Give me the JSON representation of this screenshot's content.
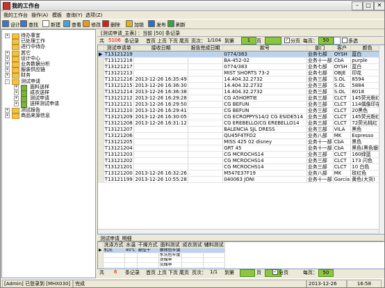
{
  "window": {
    "title": "我的工作台"
  },
  "menu": [
    "我的工作台",
    "操作(A)",
    "模板",
    "查询(Y)",
    "选项(Z)"
  ],
  "toolbar": [
    {
      "label": "设计",
      "color": "#3b78c8"
    },
    {
      "label": "查找",
      "color": "#3b78c8"
    },
    {
      "label": "新建",
      "color": "#ffffff"
    },
    {
      "label": "查看",
      "color": "#4aa0d8"
    },
    {
      "label": "修改",
      "color": "#e09a2a"
    },
    {
      "label": "删除",
      "color": "#d02020"
    },
    {
      "label": "加锁",
      "color": "#e0b020"
    },
    {
      "label": "发布",
      "color": "#3070c0"
    },
    {
      "label": "刷新",
      "color": "#40a040"
    }
  ],
  "tree": [
    {
      "label": "待办事宜",
      "indent": 0,
      "exp": "+"
    },
    {
      "label": "已处理工作",
      "indent": 0,
      "exp": ""
    },
    {
      "label": "进行中待办",
      "indent": 0,
      "exp": ""
    },
    {
      "label": "其它",
      "indent": 0,
      "exp": "+"
    },
    {
      "label": "设计中心",
      "indent": 0,
      "exp": "+"
    },
    {
      "label": "业务数据分析",
      "indent": 0,
      "exp": "+"
    },
    {
      "label": "服装供应链",
      "indent": 0,
      "exp": "+"
    },
    {
      "label": "财务",
      "indent": 0,
      "exp": "+"
    },
    {
      "label": "测试申请",
      "indent": 0,
      "exp": "-"
    },
    {
      "label": "面料送样",
      "indent": 1,
      "exp": "+"
    },
    {
      "label": "成衣送样",
      "indent": 1,
      "exp": "+"
    },
    {
      "label": "测试申请",
      "indent": 1,
      "exp": "+"
    },
    {
      "label": "送样测试申请",
      "indent": 1,
      "exp": "+"
    },
    {
      "label": "测试报告",
      "indent": 0,
      "exp": "+"
    },
    {
      "label": "商品来源信息",
      "indent": 0,
      "exp": "+"
    }
  ],
  "main": {
    "tab_title": "[测试申请_主表] ：当前 [50] 条记录",
    "pager": {
      "total_label": "共",
      "total": "5106",
      "records_label": "条记录",
      "first": "首页",
      "prev": "上页",
      "next": "下页",
      "last": "尾页",
      "page_label": "页次：",
      "page": "1/104",
      "goto_label": "到第",
      "goto_value": "1",
      "page_unit": "页",
      "split_label": "分页",
      "per_page_label": "每页：",
      "per_page": "50",
      "multi_label": "多选"
    },
    "columns": [
      "测试申请单",
      "接收日期",
      "报告完成日期",
      "款号",
      "部门",
      "客户",
      "颜色"
    ],
    "rows": [
      [
        "T13121219",
        "",
        "",
        "0774/383",
        "业务七部",
        "OYSH",
        "蓝白"
      ],
      [
        "T13121218",
        "",
        "",
        "BA-452-02",
        "业务十一部",
        "CbA",
        "purple"
      ],
      [
        "T13121217",
        "",
        "",
        "0774/383",
        "业务七部",
        "OYSH",
        "蓝白"
      ],
      [
        "T13121213",
        "",
        "",
        "MIST SHORTS 73-2",
        "业务七部",
        "OBJE",
        "印花"
      ],
      [
        "T13121216",
        "2013-12-26 16:35:49",
        "",
        "14.404.32.2732",
        "业务三部",
        "S.OL",
        "8594"
      ],
      [
        "T13121215",
        "2013-12-26 16:36:30",
        "",
        "14.404.32.2732",
        "业务三部",
        "S.OL",
        "5884"
      ],
      [
        "T13121214",
        "2013-12-26 16:36:38",
        "",
        "14.404.32.2732",
        "业务三部",
        "S.OL",
        "8018"
      ],
      [
        "T13121212",
        "2013-12-26 16:29:28",
        "",
        "CG A5HORTIE",
        "业务三部",
        "CLCT",
        "145荧光粉红"
      ],
      [
        "T13121211",
        "2013-12-26 16:29:50",
        "",
        "CG BEFUN",
        "业务三部",
        "CLCT",
        "114偶像印花"
      ],
      [
        "T13121210",
        "2013-12-26 16:29:41",
        "",
        "CG BEFUN",
        "业务三部",
        "CLCT",
        "20黑色"
      ],
      [
        "T13121209",
        "2013-12-26 16:30:05",
        "",
        "CG ECROPPYS14/2 CG ESIDE514",
        "业务三部",
        "CLCT",
        "145荧光粉红"
      ],
      [
        "T13121208",
        "2013-12-26 16:31:12",
        "",
        "CG EREBELLO/CG EREBELLO14",
        "业务三部",
        "CLCT",
        "72荧光桃红"
      ],
      [
        "T13121207",
        "",
        "",
        "BALENCIA SJL DRESS",
        "业务三部",
        "VILA",
        "黑色"
      ],
      [
        "T13121206",
        "",
        "",
        "QU45F4TFD2",
        "业务八部",
        "MK",
        "Espresso"
      ],
      [
        "T13121205",
        "",
        "",
        "MISS 425 02 disney",
        "业务十一部",
        "CbA",
        "黑色"
      ],
      [
        "T13121204",
        "",
        "",
        "GRT 45",
        "业务十一部",
        "CbA",
        "黑色(黑色银箔"
      ],
      [
        "T13121203",
        "",
        "",
        "CG MCROCHS14",
        "业务三部",
        "CLCT",
        "160绿蓝"
      ],
      [
        "T13121202",
        "",
        "",
        "CG MCROCHS14",
        "业务三部",
        "CLCT",
        "173 闪色"
      ],
      [
        "T13121201",
        "",
        "",
        "CG MCROCHS14",
        "业务三部",
        "CLCT",
        "10 白色"
      ],
      [
        "T13121200",
        "2013-12-26 16:32:26",
        "",
        "M547E37F19",
        "业务八部",
        "MK",
        "玫红色"
      ],
      [
        "T13121199",
        "2013-12-26 10:55:28",
        "",
        "040063 JONI",
        "业务十一部",
        "Garcia",
        "黄色(大货)"
      ]
    ]
  },
  "detail": {
    "tab_title": "测试申请_明细",
    "columns": [
      "洗涤方式",
      "水温",
      "干燥方式",
      "面料测试",
      "成衣测试",
      "辅料测试"
    ],
    "rows": [
      [
        "机洗",
        "40℃",
        "悬挂干",
        "摩擦色牢度",
        "",
        ""
      ],
      [
        "",
        "",
        "",
        "水洗色牢度",
        "",
        ""
      ],
      [
        "",
        "",
        "",
        "烫缩率",
        "",
        ""
      ],
      [
        "",
        "",
        "",
        "洗缩率",
        "",
        ""
      ],
      [
        "",
        "",
        "",
        "",
        "",
        " "
      ]
    ],
    "pager": {
      "total_label": "共",
      "total": "6",
      "records_label": "条记录",
      "first": "首页",
      "prev": "上页",
      "next": "下页",
      "last": "尾页",
      "page_label": "页次：",
      "page": "1/1",
      "goto_label": "到第",
      "page_unit": "页",
      "split_label": "分页",
      "per_page_label": "每页：",
      "per_page": "50"
    }
  },
  "status": {
    "user": "[Admin] 已登录到 [MHX030]",
    "state": "完成",
    "date": "2013-12-26",
    "time": "16:58"
  }
}
